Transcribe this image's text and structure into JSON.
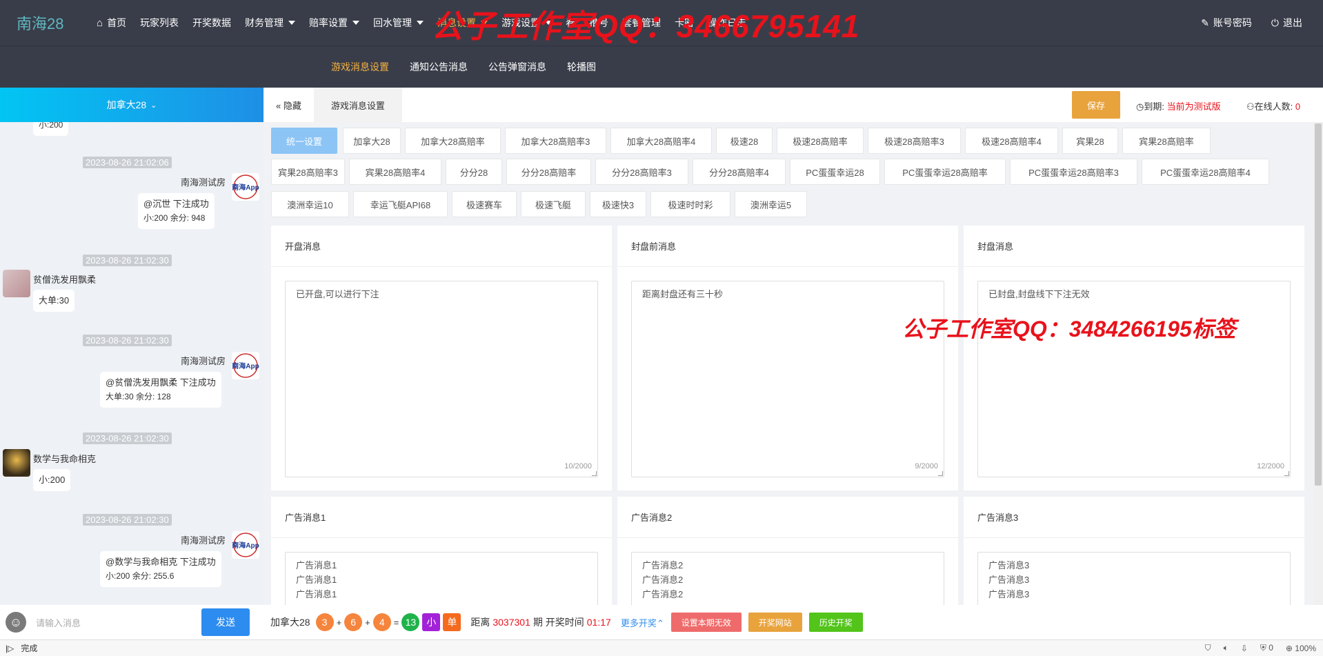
{
  "watermarks": {
    "top": "公子工作室QQ：3466795141",
    "mid": "公子工作室QQ：3484266195标签"
  },
  "topnav": {
    "logo": "南海28",
    "items": [
      {
        "label": "首页",
        "dropdown": false
      },
      {
        "label": "玩家列表",
        "dropdown": false
      },
      {
        "label": "开奖数据",
        "dropdown": false
      },
      {
        "label": "财务管理",
        "dropdown": true
      },
      {
        "label": "赔率设置",
        "dropdown": true
      },
      {
        "label": "回水管理",
        "dropdown": true
      },
      {
        "label": "消息设置",
        "dropdown": true,
        "active": true
      },
      {
        "label": "游戏设置",
        "dropdown": true
      },
      {
        "label": "春",
        "dropdown": false
      },
      {
        "label": "推号",
        "dropdown": false
      },
      {
        "label": "套餐管理",
        "dropdown": false
      },
      {
        "label": "卡密",
        "dropdown": false
      },
      {
        "label": "操作日志",
        "dropdown": false
      }
    ],
    "account": "账号密码",
    "logout": "退出"
  },
  "subnav": [
    "游戏消息设置",
    "通知公告消息",
    "公告弹窗消息",
    "轮播图"
  ],
  "room": {
    "name": "加拿大28"
  },
  "chat": {
    "top_partial": "小:200",
    "messages": [
      {
        "time": "2023-08-26 21:02:06",
        "sender": "南海测试房",
        "line1": "@沉世 下注成功",
        "line2": "小:200 余分: 948",
        "side": "right"
      },
      {
        "time": "2023-08-26 21:02:30",
        "sender": "贫僧洗发用飘柔",
        "line1": "大单:30",
        "side": "left"
      },
      {
        "time": "2023-08-26 21:02:30",
        "sender": "南海测试房",
        "line1": "@贫僧洗发用飘柔 下注成功",
        "line2": "大单:30 余分: 128",
        "side": "right"
      },
      {
        "time": "2023-08-26 21:02:30",
        "sender": "数学与我命相克",
        "line1": "小:200",
        "side": "left"
      },
      {
        "time": "2023-08-26 21:02:30",
        "sender": "南海测试房",
        "line1": "@数学与我命相克 下注成功",
        "line2": "小:200 余分: 255.6",
        "side": "right"
      }
    ],
    "input_placeholder": "请输入消息",
    "send": "发送",
    "app_badge": "南海App"
  },
  "toolbar": {
    "hide": "隐藏",
    "tab": "游戏消息设置",
    "save": "保存",
    "expire_label": "到期:",
    "expire_value": "当前为测试版",
    "online_label": "在线人数:",
    "online_value": "0"
  },
  "game_tags": [
    "统一设置",
    "加拿大28",
    "加拿大28高赔率",
    "加拿大28高赔率3",
    "加拿大28高赔率4",
    "极速28",
    "极速28高赔率",
    "极速28高赔率3",
    "极速28高赔率4",
    "宾果28",
    "宾果28高赔率",
    "宾果28高赔率3",
    "宾果28高赔率4",
    "分分28",
    "分分28高赔率",
    "分分28高赔率3",
    "分分28高赔率4",
    "PC蛋蛋幸运28",
    "PC蛋蛋幸运28高赔率",
    "PC蛋蛋幸运28高赔率3",
    "PC蛋蛋幸运28高赔率4",
    "澳洲幸运10",
    "幸运飞艇API68",
    "极速赛车",
    "极速飞艇",
    "极速快3",
    "极速时时彩",
    "澳洲幸运5"
  ],
  "cards": [
    {
      "title": "开盘消息",
      "text": "已开盘,可以进行下注",
      "count": "10/2000"
    },
    {
      "title": "封盘前消息",
      "text": "距离封盘还有三十秒",
      "count": "9/2000"
    },
    {
      "title": "封盘消息",
      "text": "已封盘,封盘线下下注无效",
      "count": "12/2000"
    },
    {
      "title": "广告消息1",
      "lines": [
        "广告消息1",
        "广告消息1",
        "广告消息1"
      ]
    },
    {
      "title": "广告消息2",
      "lines": [
        "广告消息2",
        "广告消息2",
        "广告消息2"
      ]
    },
    {
      "title": "广告消息3",
      "lines": [
        "广告消息3",
        "广告消息3",
        "广告消息3"
      ]
    }
  ],
  "draw": {
    "game": "加拿大28",
    "n1": "3",
    "n2": "6",
    "n3": "4",
    "sum": "13",
    "size": "小",
    "parity": "单",
    "distance_label": "距离",
    "period": "3037301",
    "period_label": "期 开奖时间",
    "time": "01:17",
    "more": "更多开奖",
    "btn_invalid": "设置本期无效",
    "btn_site": "开奖网站",
    "btn_history": "历史开奖"
  },
  "status": {
    "text": "完成",
    "zoom": "100%",
    "badge1": "0",
    "badge2": "0"
  },
  "colors": {
    "accent": "#f5b142",
    "nav_bg": "#393d49",
    "save": "#e8a33d",
    "danger": "#e8121b"
  }
}
